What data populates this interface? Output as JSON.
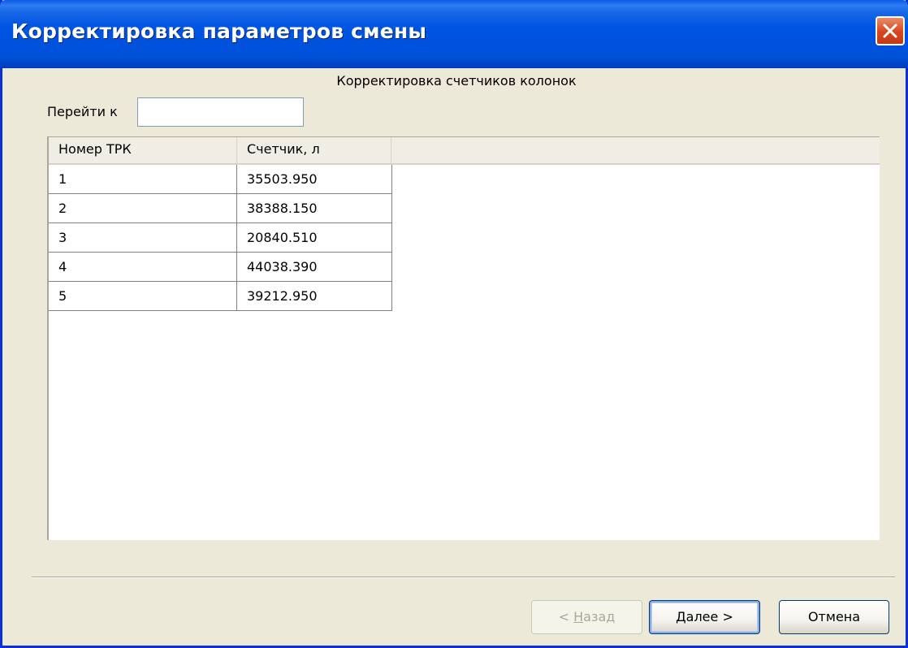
{
  "window": {
    "title": "Корректировка параметров смены"
  },
  "content": {
    "subtitle": "Корректировка счетчиков колонок",
    "goto_label": "Перейти к",
    "goto_value": ""
  },
  "table": {
    "columns": [
      "Номер ТРК",
      "Счетчик, л"
    ],
    "rows": [
      [
        "1",
        "35503.950"
      ],
      [
        "2",
        "38388.150"
      ],
      [
        "3",
        "20840.510"
      ],
      [
        "4",
        "44038.390"
      ],
      [
        "5",
        "39212.950"
      ]
    ]
  },
  "buttons": {
    "back": {
      "prefix": "< ",
      "accel": "Н",
      "rest": "азад",
      "enabled": false
    },
    "next": {
      "accel": "Д",
      "rest": "алее >",
      "enabled": true
    },
    "cancel": {
      "label": "Отмена",
      "enabled": true
    }
  },
  "colors": {
    "titlebar": "#0054e3",
    "close_button": "#d8451f",
    "dialog_background": "#ece9d8"
  }
}
